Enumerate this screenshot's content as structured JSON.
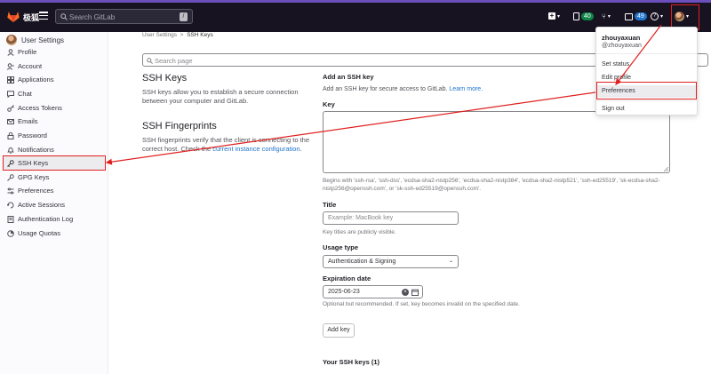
{
  "topbar": {
    "logo_text": "极狐",
    "search_placeholder": "Search GitLab",
    "search_shortcut": "/",
    "plus_label": "+",
    "mr_count": "40",
    "todo_count": "49",
    "help_label": "?"
  },
  "sidebar": {
    "title": "User Settings",
    "items": [
      {
        "label": "Profile"
      },
      {
        "label": "Account"
      },
      {
        "label": "Applications"
      },
      {
        "label": "Chat"
      },
      {
        "label": "Access Tokens"
      },
      {
        "label": "Emails"
      },
      {
        "label": "Password"
      },
      {
        "label": "Notifications"
      },
      {
        "label": "SSH Keys"
      },
      {
        "label": "GPG Keys"
      },
      {
        "label": "Preferences"
      },
      {
        "label": "Active Sessions"
      },
      {
        "label": "Authentication Log"
      },
      {
        "label": "Usage Quotas"
      }
    ]
  },
  "breadcrumb": {
    "parent": "User Settings",
    "current": "SSH Keys"
  },
  "page_search_placeholder": "Search page",
  "ssh_keys": {
    "heading": "SSH Keys",
    "description": "SSH keys allow you to establish a secure connection between your computer and GitLab."
  },
  "fingerprints": {
    "heading": "SSH Fingerprints",
    "desc_before": "SSH fingerprints verify that the client is connecting to the correct host. Check the ",
    "link": "current instance configuration",
    "desc_after": "."
  },
  "form": {
    "add_heading": "Add an SSH key",
    "add_desc": "Add an SSH key for secure access to GitLab. ",
    "learn_more": "Learn more.",
    "key_label": "Key",
    "key_help": "Begins with 'ssh-rsa', 'ssh-dss', 'ecdsa-sha2-nistp256', 'ecdsa-sha2-nistp384', 'ecdsa-sha2-nistp521', 'ssh-ed25519', 'sk-ecdsa-sha2-nistp256@openssh.com', or 'sk-ssh-ed25519@openssh.com'.",
    "title_label": "Title",
    "title_placeholder": "Example: MacBook key",
    "title_help": "Key titles are publicly visible.",
    "usage_label": "Usage type",
    "usage_value": "Authentication & Signing",
    "expiration_label": "Expiration date",
    "expiration_value": "2025-06-23",
    "expiration_help": "Optional but recommended. If set, key becomes invalid on the specified date.",
    "add_button": "Add key",
    "your_keys": "Your SSH keys (1)"
  },
  "dropdown": {
    "name": "zhouyaxuan",
    "username": "@zhouyaxuan",
    "items": [
      {
        "label": "Set status"
      },
      {
        "label": "Edit profile"
      },
      {
        "label": "Preferences"
      },
      {
        "label": "Sign out"
      }
    ]
  },
  "colors": {
    "annotation": "#e02020",
    "topbar": "#171321",
    "link": "#1f75cb"
  }
}
